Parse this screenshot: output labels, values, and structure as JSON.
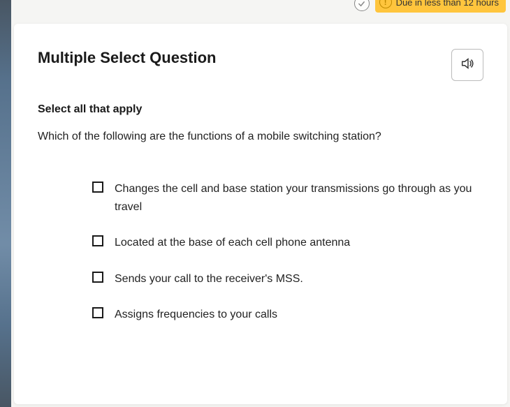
{
  "topbar": {
    "check_icon_label": "check",
    "warning_icon_label": "!",
    "due_text": "Due in less than 12 hours"
  },
  "question": {
    "type_label": "Multiple Select Question",
    "instruction": "Select all that apply",
    "prompt": "Which of the following are the functions of a mobile switching station?",
    "options": [
      "Changes the cell and base station your transmissions go through as you travel",
      "Located at the base of each cell phone antenna",
      "Sends your call to the receiver's MSS.",
      "Assigns frequencies to your calls"
    ]
  }
}
